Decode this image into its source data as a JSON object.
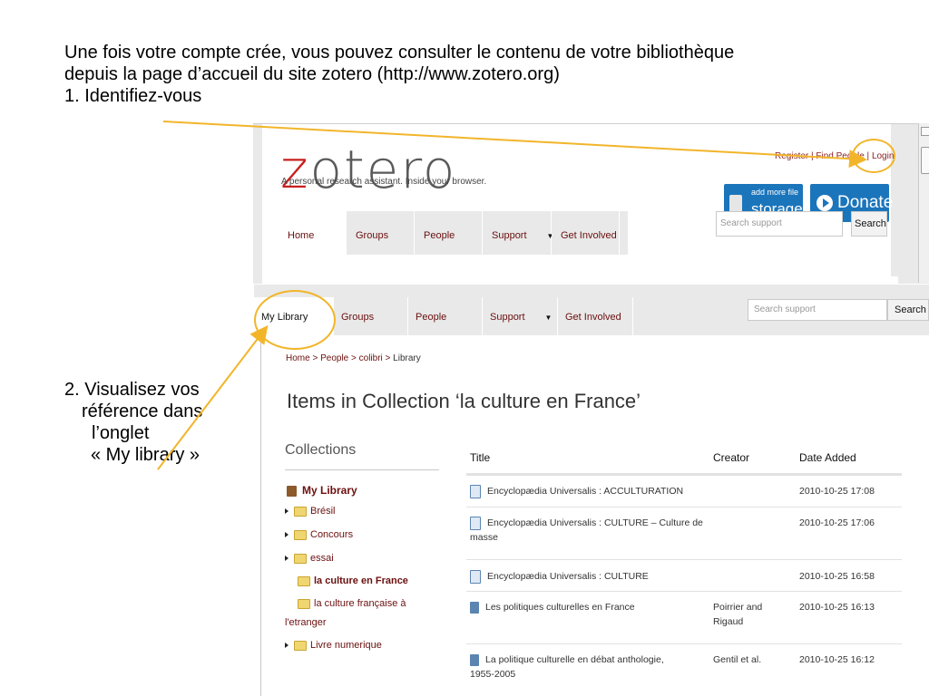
{
  "intro": {
    "line1": "Une fois votre compte crée, vous pouvez consulter le contenu de votre bibliothèque",
    "line2": "depuis la page d’accueil du site zotero (http://www.zotero.org)",
    "line3": "1. Identifiez-vous"
  },
  "step2": {
    "line1": "2. Visualisez vos",
    "line2": "référence  dans",
    "line3": "l’onglet",
    "line4": "« My library »"
  },
  "zotero_header": {
    "logo_z": "z",
    "logo_rest": "otero",
    "tagline": "A personal research assistant. Inside your browser.",
    "links": [
      "Register",
      "Find People",
      "Login"
    ],
    "link_sep": " | ",
    "storage_small_1": "add more file",
    "storage_big": "storage",
    "donate": "Donate",
    "nav": [
      "Home",
      "Groups",
      "People",
      "Support",
      "Get Involved"
    ],
    "nav_support_arrow": "▼",
    "search_placeholder": "Search support",
    "search_button": "Search"
  },
  "library_page": {
    "nav": [
      "My Library",
      "Groups",
      "People",
      "Support",
      "Get Involved"
    ],
    "nav_support_arrow": "▼",
    "search_placeholder": "Search support",
    "search_button": "Search",
    "breadcrumb": [
      "Home",
      "People",
      "colibri",
      "Library"
    ],
    "breadcrumb_sep": " > ",
    "page_title": "Items in Collection ‘la culture en France’",
    "collections_heading": "Collections",
    "collections": {
      "root": "My Library",
      "bresil": "Brésil",
      "concours": "Concours",
      "essai": "essai",
      "culture_france": "la culture en France",
      "culture_fr_etranger_1": "la culture française à",
      "culture_fr_etranger_2": "l'etranger",
      "livre": "Livre numerique"
    },
    "columns": [
      "Title",
      "Creator",
      "Date Added"
    ],
    "rows": [
      {
        "title_1": "Encyclopædia Universalis : ACCULTURATION",
        "title_2": "",
        "creator_1": "",
        "creator_2": "",
        "date": "2010-10-25 17:08",
        "type": "document"
      },
      {
        "title_1": "Encyclopædia Universalis : CULTURE – Culture de",
        "title_2": "masse",
        "creator_1": "",
        "creator_2": "",
        "date": "2010-10-25 17:06",
        "type": "document"
      },
      {
        "title_1": "Encyclopædia Universalis : CULTURE",
        "title_2": "",
        "creator_1": "",
        "creator_2": "",
        "date": "2010-10-25 16:58",
        "type": "document"
      },
      {
        "title_1": "Les politiques culturelles en France",
        "title_2": "",
        "creator_1": "Poirrier and",
        "creator_2": "Rigaud",
        "date": "2010-10-25 16:13",
        "type": "book"
      },
      {
        "title_1": "La politique culturelle en débat anthologie,",
        "title_2": "1955-2005",
        "creator_1": "Gentil et al.",
        "creator_2": "",
        "date": "2010-10-25 16:12",
        "type": "book"
      }
    ]
  },
  "colors": {
    "accent_ring": "#f2b52a",
    "zotero_red": "#c8201f",
    "link_red": "#6b0f0f",
    "button_blue": "#1b75bb"
  }
}
